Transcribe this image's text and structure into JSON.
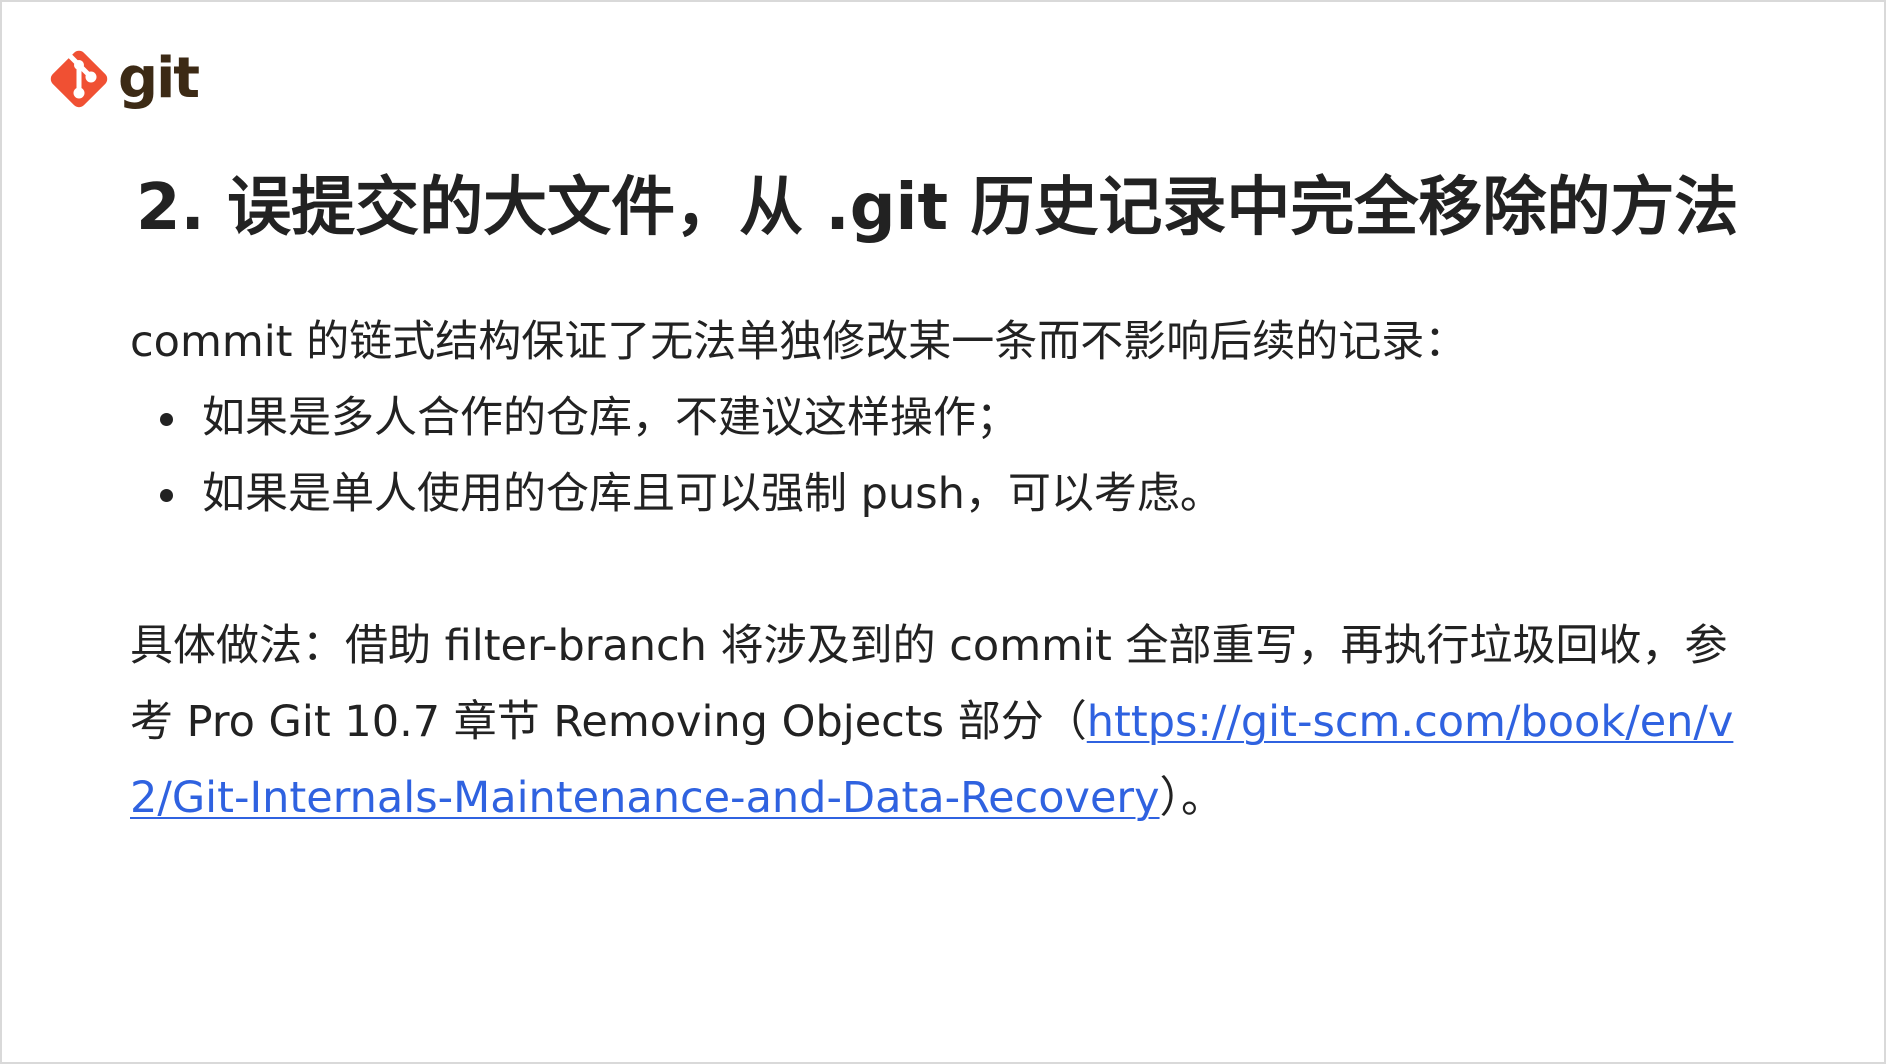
{
  "logo": {
    "text": "git",
    "icon": "git-logo-icon",
    "color": "#f05033"
  },
  "slide": {
    "title": "2. 误提交的大文件，从 .git 历史记录中完全移除的方法",
    "intro": "commit 的链式结构保证了无法单独修改某一条而不影响后续的记录：",
    "bullets": [
      {
        "text": "如果是多人合作的仓库，不建议这样操作；"
      },
      {
        "text": "如果是单人使用的仓库且可以强制 push，可以考虑。"
      }
    ],
    "method": {
      "prefix": "具体做法：借助 filter-branch 将涉及到的 commit 全部重写，再执行垃圾回收，参考 Pro Git 10.7 章节 Removing Objects 部分（",
      "link_text": "https://git-scm.com/book/en/v2/Git-Internals-Maintenance-and-Data-Recovery",
      "suffix": "）。"
    }
  },
  "colors": {
    "text": "#222222",
    "link": "#2f62e0",
    "border": "#d9d9d9"
  }
}
